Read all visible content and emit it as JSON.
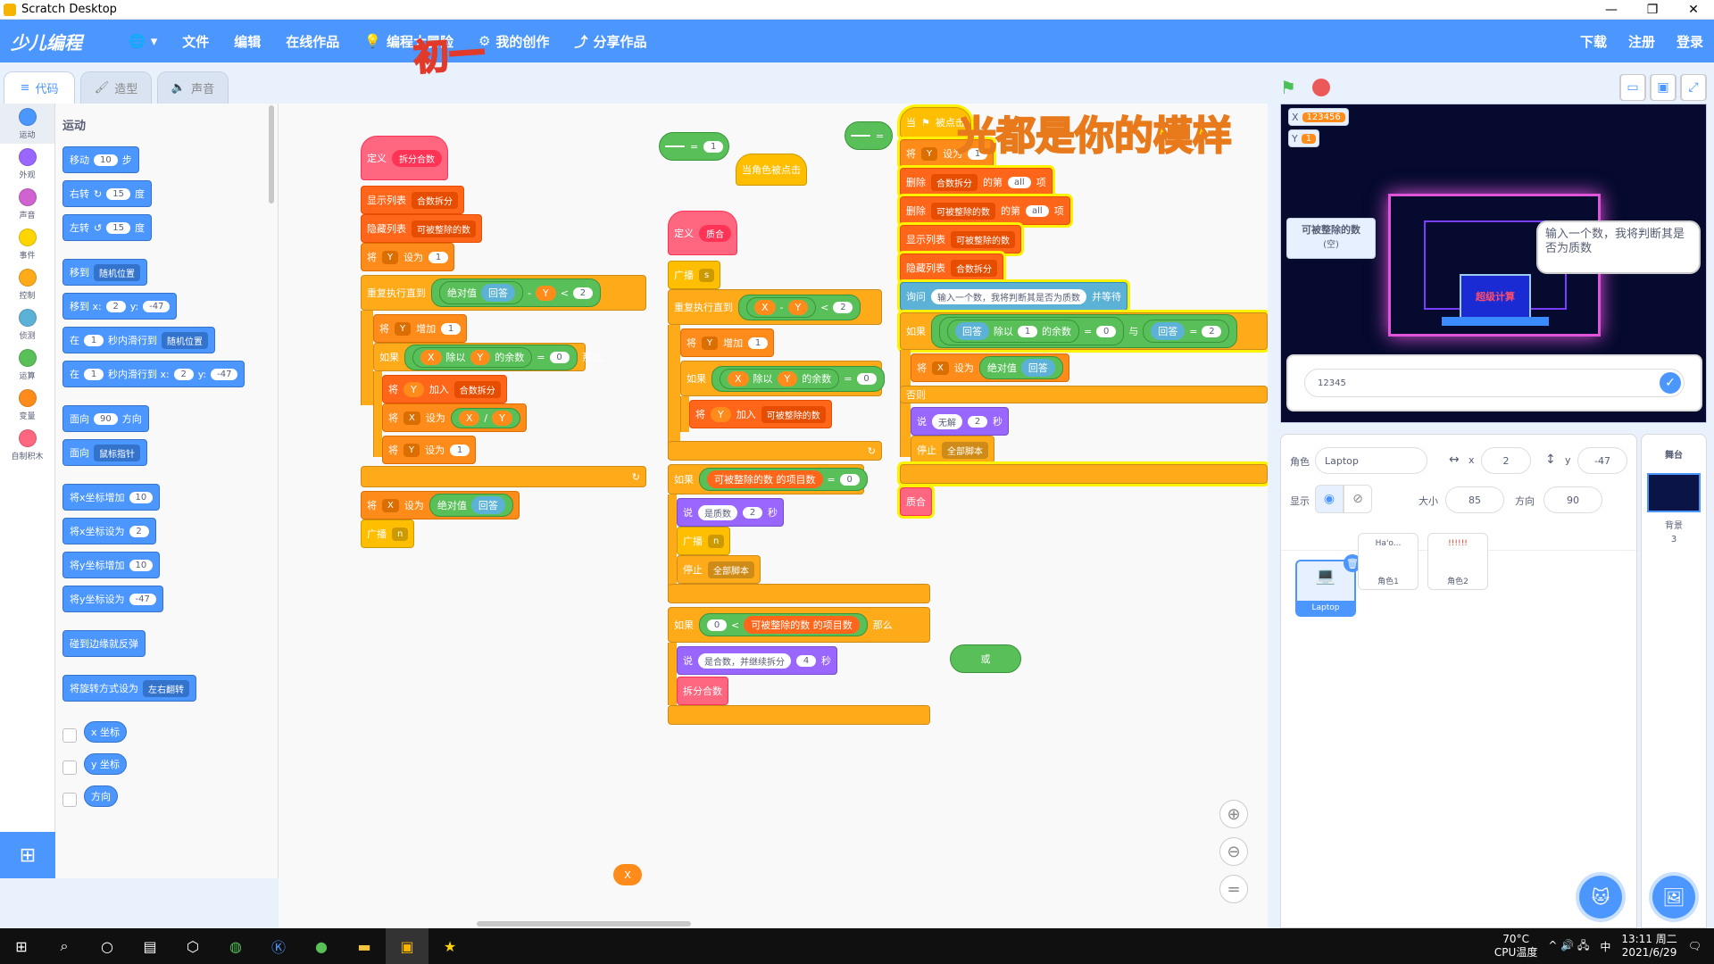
{
  "window": {
    "title": "Scratch Desktop",
    "controls": [
      "—",
      "❐",
      "✕"
    ]
  },
  "menu": {
    "logo": "少儿编程",
    "items": [
      "文件",
      "编辑",
      "在线作品",
      "编程大冒险",
      "我的创作",
      "分享作品"
    ],
    "right": [
      "下载",
      "注册",
      "登录"
    ],
    "overlay": "初一"
  },
  "tabs": [
    "代码",
    "造型",
    "声音"
  ],
  "categories": [
    {
      "label": "运动",
      "color": "#4c97ff"
    },
    {
      "label": "外观",
      "color": "#9966ff"
    },
    {
      "label": "声音",
      "color": "#cf63cf"
    },
    {
      "label": "事件",
      "color": "#ffd500"
    },
    {
      "label": "控制",
      "color": "#ffab19"
    },
    {
      "label": "侦测",
      "color": "#5cb1d6"
    },
    {
      "label": "运算",
      "color": "#59c059"
    },
    {
      "label": "变量",
      "color": "#ff8c1a"
    },
    {
      "label": "自制积木",
      "color": "#ff6680"
    }
  ],
  "palette": {
    "title": "运动",
    "move": {
      "a": "移动",
      "v": "10",
      "b": "步"
    },
    "turn_right": {
      "a": "右转",
      "v": "15",
      "b": "度"
    },
    "turn_left": {
      "a": "左转",
      "v": "15",
      "b": "度"
    },
    "goto": {
      "a": "移到",
      "dd": "随机位置"
    },
    "goto_xy": {
      "a": "移到 x:",
      "x": "2",
      "b": "y:",
      "y": "-47"
    },
    "glide": {
      "a": "在",
      "v": "1",
      "b": "秒内滑行到",
      "dd": "随机位置"
    },
    "glide_xy": {
      "a": "在",
      "v": "1",
      "b": "秒内滑行到 x:",
      "x": "2",
      "c": "y:",
      "y": "-47"
    },
    "point": {
      "a": "面向",
      "v": "90",
      "b": "方向"
    },
    "point_to": {
      "a": "面向",
      "dd": "鼠标指针"
    },
    "change_x": {
      "a": "将x坐标增加",
      "v": "10"
    },
    "set_x": {
      "a": "将x坐标设为",
      "v": "2"
    },
    "change_y": {
      "a": "将y坐标增加",
      "v": "10"
    },
    "set_y": {
      "a": "将y坐标设为",
      "v": "-47"
    },
    "bounce": "碰到边缘就反弹",
    "rotation": {
      "a": "将旋转方式设为",
      "dd": "左右翻转"
    },
    "reporters": [
      "x 坐标",
      "y 坐标",
      "方向"
    ]
  },
  "script1": {
    "define": {
      "a": "定义",
      "name": "拆分合数"
    },
    "show_list": {
      "a": "显示列表",
      "dd": "合数拆分"
    },
    "hide_list": {
      "a": "隐藏列表",
      "dd": "可被整除的数"
    },
    "set_y": {
      "a": "将",
      "var": "Y",
      "b": "设为",
      "v": "1"
    },
    "repeat_until": {
      "a": "重复执行直到",
      "abs": "绝对值",
      "ans": "回答",
      "minus": "-",
      "y": "Y",
      "lt": "<",
      "v": "2"
    },
    "change_y": {
      "a": "将",
      "var": "Y",
      "b": "增加",
      "v": "1"
    },
    "if1": {
      "a": "如果",
      "x": "X",
      "mod": "除以",
      "y": "Y",
      "rem": "的余数",
      "eq": "=",
      "v": "0",
      "then": "那么"
    },
    "add": {
      "a": "将",
      "y": "Y",
      "b": "加入",
      "dd": "合数拆分"
    },
    "set_x": {
      "a": "将",
      "var": "X",
      "b": "设为",
      "x": "X",
      "div": "/",
      "y": "Y"
    },
    "set_y2": {
      "a": "将",
      "var": "Y",
      "b": "设为",
      "v": "1"
    },
    "set_x_abs": {
      "a": "将",
      "var": "X",
      "b": "设为",
      "abs": "绝对值",
      "ans": "回答"
    },
    "broadcast": {
      "a": "广播",
      "dd": "n"
    }
  },
  "script2": {
    "define": {
      "a": "定义",
      "name": "质合"
    },
    "broadcast": {
      "a": "广播",
      "dd": "s"
    },
    "repeat_until": {
      "a": "重复执行直到",
      "x": "X",
      "minus": "-",
      "y": "Y",
      "lt": "<",
      "v": "2"
    },
    "change_y": {
      "a": "将",
      "var": "Y",
      "b": "增加",
      "v": "1"
    },
    "if1": {
      "a": "如果",
      "x": "X",
      "mod": "除以",
      "y": "Y",
      "rem": "的余数",
      "eq": "=",
      "v": "0"
    },
    "add": {
      "a": "将",
      "y": "Y",
      "b": "加入",
      "dd": "可被整除的数"
    },
    "if2": {
      "a": "如果",
      "dd": "可被整除的数",
      "count": "的项目数",
      "eq": "=",
      "v": "0"
    },
    "say": {
      "a": "说",
      "text": "是质数",
      "v": "2",
      "b": "秒"
    },
    "broadcast2": {
      "a": "广播",
      "dd": "n"
    },
    "stop": {
      "a": "停止",
      "dd": "全部脚本"
    },
    "if3": {
      "a": "如果",
      "v": "0",
      "lt": "<",
      "dd": "可被整除的数",
      "count": "的项目数",
      "then": "那么"
    },
    "say2": {
      "a": "说",
      "text": "是合数，并继续拆分",
      "v": "4",
      "b": "秒"
    },
    "call": "拆分合数"
  },
  "floating": {
    "eq_a": "=",
    "eq_v": "1",
    "sprite_clicked": "当角色被点击",
    "or": "或",
    "x_reporter": "X",
    "eq_b": "="
  },
  "script3": {
    "hat": {
      "a": "当",
      "b": "被点击"
    },
    "set_y": {
      "a": "将",
      "var": "Y",
      "b": "设为",
      "v": "1"
    },
    "del1": {
      "a": "删除",
      "dd": "合数拆分",
      "b": "的第",
      "v": "all",
      "c": "项"
    },
    "del2": {
      "a": "删除",
      "dd": "可被整除的数",
      "b": "的第",
      "v": "all",
      "c": "项"
    },
    "show_list": {
      "a": "显示列表",
      "dd": "可被整除的数"
    },
    "hide_list": {
      "a": "隐藏列表",
      "dd": "合数拆分"
    },
    "ask": {
      "a": "询问",
      "text": "输入一个数，我将判断其是否为质数",
      "b": "并等待"
    },
    "if": {
      "a": "如果",
      "ans": "回答",
      "mod": "除以",
      "v": "1",
      "rem": "的余数",
      "eq": "=",
      "v2": "0",
      "and": "与",
      "ans2": "回答",
      "eq2": "=",
      "v3": "2"
    },
    "set_x": {
      "a": "将",
      "var": "X",
      "b": "设为",
      "abs": "绝对值",
      "ans": "回答"
    },
    "else": "否则",
    "say": {
      "a": "说",
      "text": "无解",
      "v": "2",
      "b": "秒"
    },
    "stop": {
      "a": "停止",
      "dd": "全部脚本"
    },
    "call": "质合",
    "overlay": "光都是你的模样"
  },
  "stage": {
    "var_x": {
      "label": "X",
      "value": "123456"
    },
    "var_y": {
      "label": "Y",
      "value": "1"
    },
    "list_monitor": {
      "title": "可被整除的数",
      "content": "(空)"
    },
    "speech": "输入一个数，我将判断其是否为质数",
    "monitor_text": "超级计算",
    "answer": "12345"
  },
  "sprite_info": {
    "sprite_label": "角色",
    "sprite_name": "Laptop",
    "x_label": "x",
    "x": "2",
    "y_label": "y",
    "y": "-47",
    "show_label": "显示",
    "size_label": "大小",
    "size": "85",
    "dir_label": "方向",
    "dir": "90",
    "sprites": [
      {
        "name": "Laptop",
        "thumb": "💻"
      },
      {
        "name": "角色1",
        "thumb": "Ha'o..."
      },
      {
        "name": "角色2",
        "thumb": "!!!!!!"
      }
    ]
  },
  "stage_pane": {
    "title": "舞台",
    "bg_label": "背景",
    "bg_count": "3"
  },
  "taskbar": {
    "temp": "70°C",
    "temp_label": "CPU温度",
    "time": "13:11 周二",
    "date": "2021/6/29",
    "ime": "中",
    "tray": "^ 🔊 🖧"
  }
}
